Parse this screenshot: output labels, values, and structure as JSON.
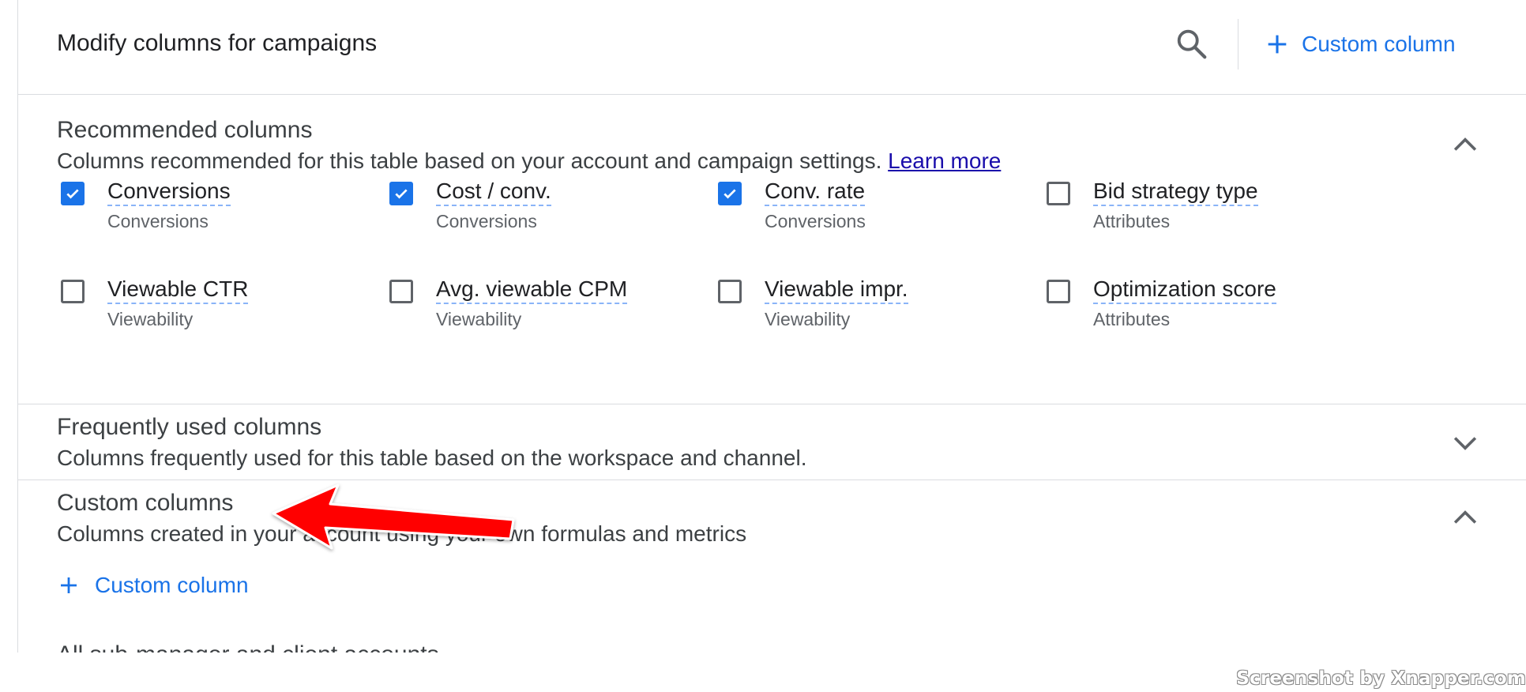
{
  "header": {
    "title": "Modify columns for campaigns",
    "search_icon": "search-icon",
    "add_custom_label": "Custom column"
  },
  "recommended": {
    "title": "Recommended columns",
    "description": "Columns recommended for this table based on your account and campaign settings.",
    "learn_more": "Learn more",
    "expanded": true,
    "options": [
      {
        "label": "Conversions",
        "category": "Conversions",
        "checked": true
      },
      {
        "label": "Cost / conv.",
        "category": "Conversions",
        "checked": true
      },
      {
        "label": "Conv. rate",
        "category": "Conversions",
        "checked": true
      },
      {
        "label": "Bid strategy type",
        "category": "Attributes",
        "checked": false
      },
      {
        "label": "Viewable CTR",
        "category": "Viewability",
        "checked": false
      },
      {
        "label": "Avg. viewable CPM",
        "category": "Viewability",
        "checked": false
      },
      {
        "label": "Viewable impr.",
        "category": "Viewability",
        "checked": false
      },
      {
        "label": "Optimization score",
        "category": "Attributes",
        "checked": false
      }
    ]
  },
  "frequent": {
    "title": "Frequently used columns",
    "description": "Columns frequently used for this table based on the workspace and channel.",
    "expanded": false
  },
  "custom": {
    "title": "Custom columns",
    "description": "Columns created in your account using your own formulas and metrics",
    "add_label": "Custom column",
    "expanded": true
  },
  "next_section": {
    "title": "All sub-manager and client accounts"
  },
  "watermark": "Screenshot by Xnapper.com",
  "colors": {
    "accent": "#1a73e8",
    "link": "#1a0dab",
    "annotation_arrow": "#ff0000"
  }
}
